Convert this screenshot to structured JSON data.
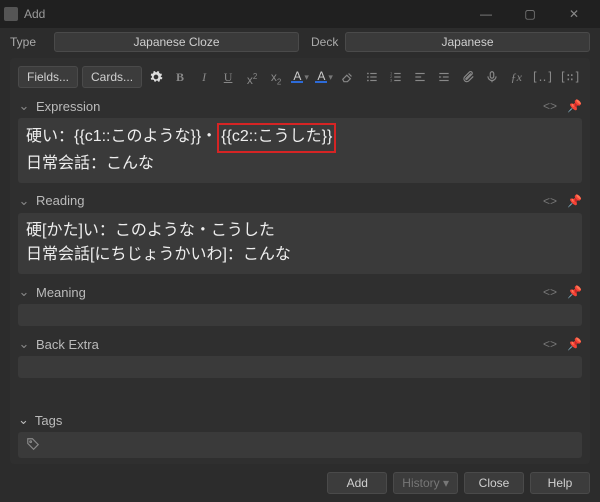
{
  "window": {
    "title": "Add"
  },
  "selectors": {
    "type_label": "Type",
    "type_value": "Japanese Cloze",
    "deck_label": "Deck",
    "deck_value": "Japanese"
  },
  "toolbar": {
    "fields": "Fields...",
    "cards": "Cards...",
    "bold": "B",
    "italic": "I",
    "underline": "U",
    "text_color_letter": "A",
    "highlight_letter": "A",
    "text_color_hex": "#2d6bd8",
    "highlight_hex": "#2d6bd8"
  },
  "fields": {
    "expression": {
      "label": "Expression",
      "line1_prefix": "硬い：{{c1::このような}}・",
      "line1_highlight": "{{c2::こうした}}",
      "line2": "日常会話：こんな"
    },
    "reading": {
      "label": "Reading",
      "line1": "硬[かた]い：このような・こうした",
      "line2": "日常会話[にちじょうかいわ]：こんな"
    },
    "meaning": {
      "label": "Meaning",
      "value": ""
    },
    "back_extra": {
      "label": "Back Extra",
      "value": ""
    }
  },
  "tags": {
    "label": "Tags"
  },
  "buttons": {
    "add": "Add",
    "history": "History ▾",
    "close": "Close",
    "help": "Help"
  }
}
